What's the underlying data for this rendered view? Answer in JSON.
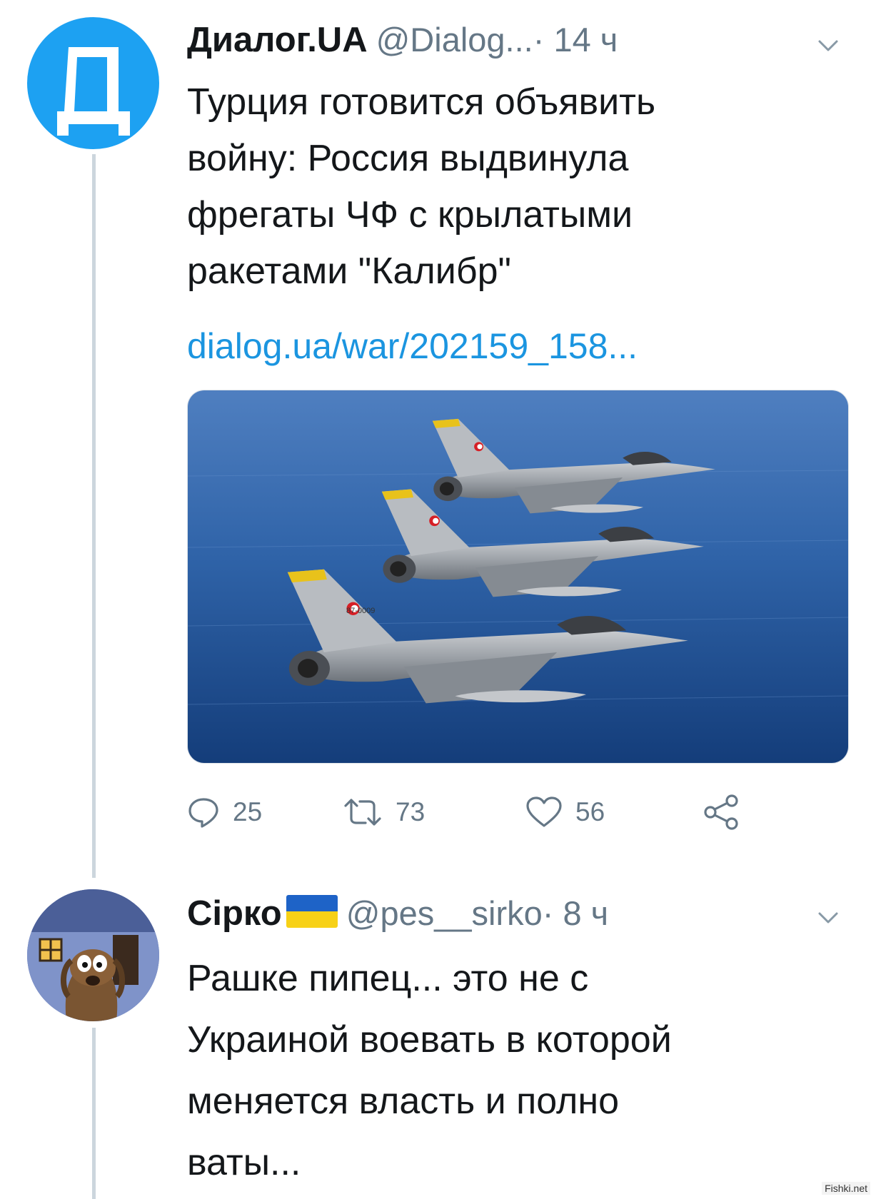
{
  "tweet1": {
    "display_name": "Диалог.UA",
    "handle": "@Dialog...",
    "time": " · 14 ч",
    "avatar_letter": "Д",
    "text": "Турция готовится объявить\nвойну: Россия выдвинула\nфрегаты ЧФ с крылатыми\nракетами \"Калибр\"",
    "link": "dialog.ua/war/202159_158...",
    "media_label": "87-0009",
    "actions": {
      "reply_count": "25",
      "retweet_count": "73",
      "like_count": "56"
    }
  },
  "tweet2": {
    "display_name": "Сірко",
    "handle": "@pes__sirko",
    "time": " · 8 ч",
    "text": "Рашке пипец... это не с\nУкраиной воевать в которой\nменяется власть и полно\nваты..."
  },
  "watermark": "Fishki.net",
  "colors": {
    "accent": "#1da1f2",
    "link": "#1b95e0",
    "muted": "#657786",
    "thread_line": "#ccd6dd",
    "flag_blue": "#1e63c7",
    "flag_yellow": "#f7d117"
  },
  "icons": [
    "reply-icon",
    "retweet-icon",
    "like-icon",
    "share-icon",
    "chevron-down-icon"
  ]
}
